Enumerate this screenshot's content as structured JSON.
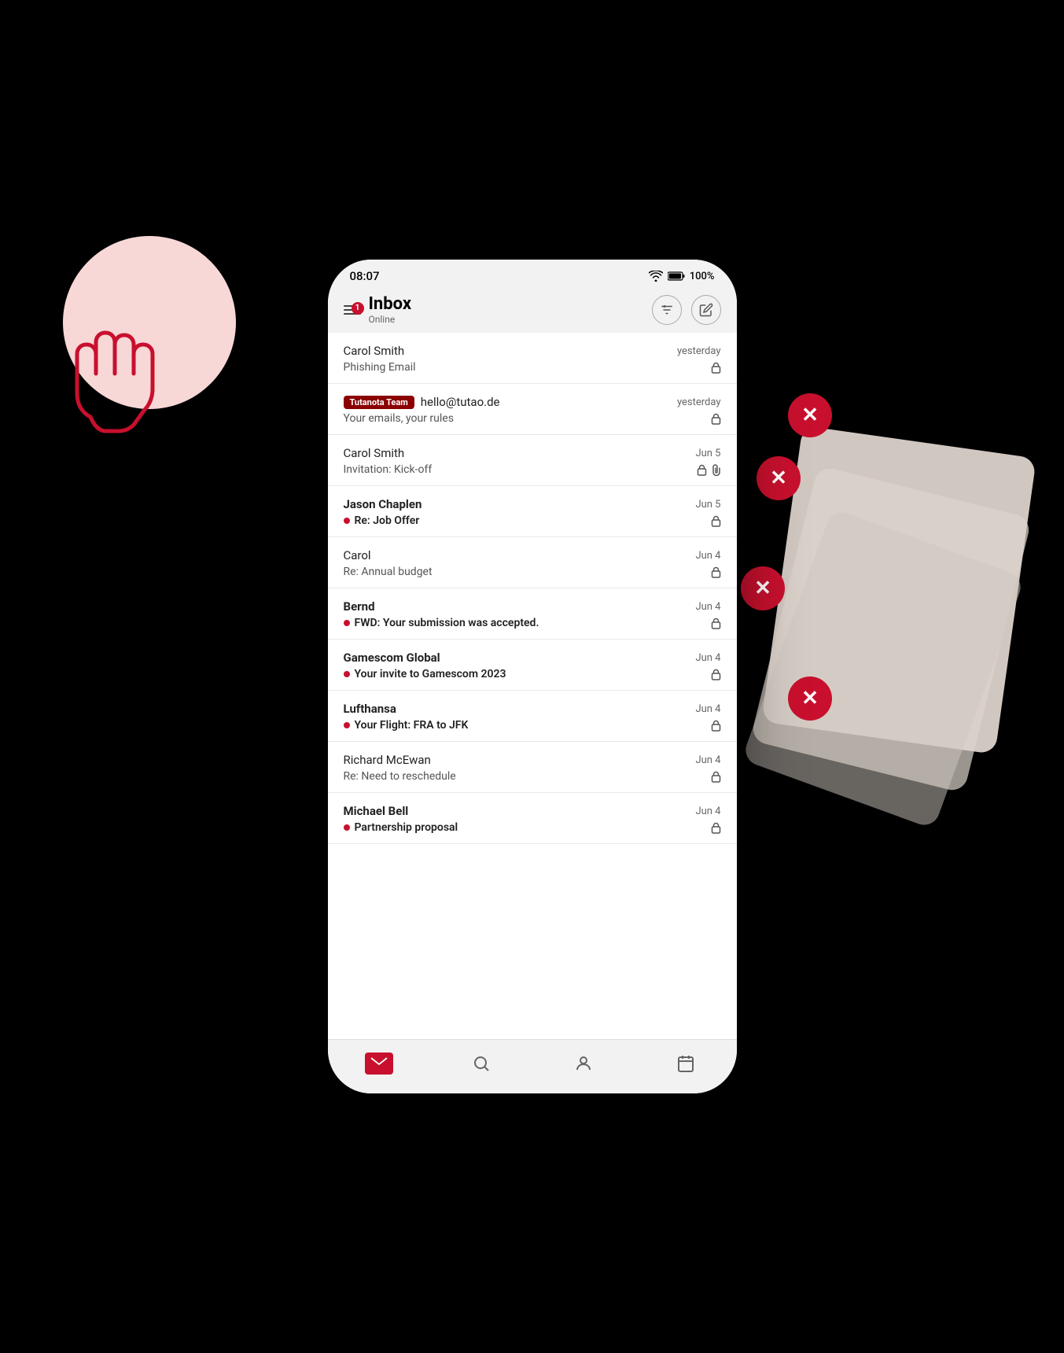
{
  "status_bar": {
    "time": "08:07",
    "battery": "100%",
    "wifi_icon": "wifi",
    "battery_icon": "battery"
  },
  "header": {
    "badge_count": "1",
    "title": "Inbox",
    "subtitle": "Online",
    "filter_icon": "filter-list",
    "compose_icon": "compose"
  },
  "emails": [
    {
      "id": 1,
      "sender": "Carol Smith",
      "date": "yesterday",
      "subject": "Phishing Email",
      "unread": false,
      "has_lock": true,
      "has_attachment": false,
      "has_unread_dot": false,
      "tutanota_team": false
    },
    {
      "id": 2,
      "sender": "hello@tutao.de",
      "date": "yesterday",
      "subject": "Your emails, your rules",
      "unread": false,
      "has_lock": true,
      "has_attachment": false,
      "has_unread_dot": false,
      "tutanota_team": true,
      "tutanota_label": "Tutanota Team"
    },
    {
      "id": 3,
      "sender": "Carol Smith",
      "date": "Jun 5",
      "subject": "Invitation: Kick-off",
      "unread": false,
      "has_lock": true,
      "has_attachment": true,
      "has_unread_dot": false,
      "tutanota_team": false
    },
    {
      "id": 4,
      "sender": "Jason Chaplen",
      "date": "Jun 5",
      "subject": "Re: Job Offer",
      "unread": true,
      "has_lock": true,
      "has_attachment": false,
      "has_unread_dot": true,
      "tutanota_team": false
    },
    {
      "id": 5,
      "sender": "Carol",
      "date": "Jun 4",
      "subject": "Re: Annual budget",
      "unread": false,
      "has_lock": true,
      "has_attachment": false,
      "has_unread_dot": false,
      "tutanota_team": false
    },
    {
      "id": 6,
      "sender": "Bernd",
      "date": "Jun 4",
      "subject": "FWD: Your submission was accepted.",
      "unread": true,
      "has_lock": true,
      "has_attachment": false,
      "has_unread_dot": true,
      "tutanota_team": false
    },
    {
      "id": 7,
      "sender": "Gamescom Global",
      "date": "Jun 4",
      "subject": "Your invite to Gamescom 2023",
      "unread": true,
      "has_lock": true,
      "has_attachment": false,
      "has_unread_dot": true,
      "tutanota_team": false
    },
    {
      "id": 8,
      "sender": "Lufthansa",
      "date": "Jun 4",
      "subject": "Your Flight: FRA to JFK",
      "unread": true,
      "has_lock": true,
      "has_attachment": false,
      "has_unread_dot": true,
      "tutanota_team": false
    },
    {
      "id": 9,
      "sender": "Richard McEwan",
      "date": "Jun 4",
      "subject": "Re: Need to reschedule",
      "unread": false,
      "has_lock": true,
      "has_attachment": false,
      "has_unread_dot": false,
      "tutanota_team": false
    },
    {
      "id": 10,
      "sender": "Michael Bell",
      "date": "Jun 4",
      "subject": "Partnership proposal",
      "unread": true,
      "has_lock": true,
      "has_attachment": false,
      "has_unread_dot": true,
      "tutanota_team": false
    }
  ],
  "bottom_nav": {
    "items": [
      {
        "id": "mail",
        "label": "Mail",
        "active": true
      },
      {
        "id": "search",
        "label": "Search",
        "active": false
      },
      {
        "id": "contacts",
        "label": "Contacts",
        "active": false
      },
      {
        "id": "calendar",
        "label": "Calendar",
        "active": false
      }
    ]
  }
}
